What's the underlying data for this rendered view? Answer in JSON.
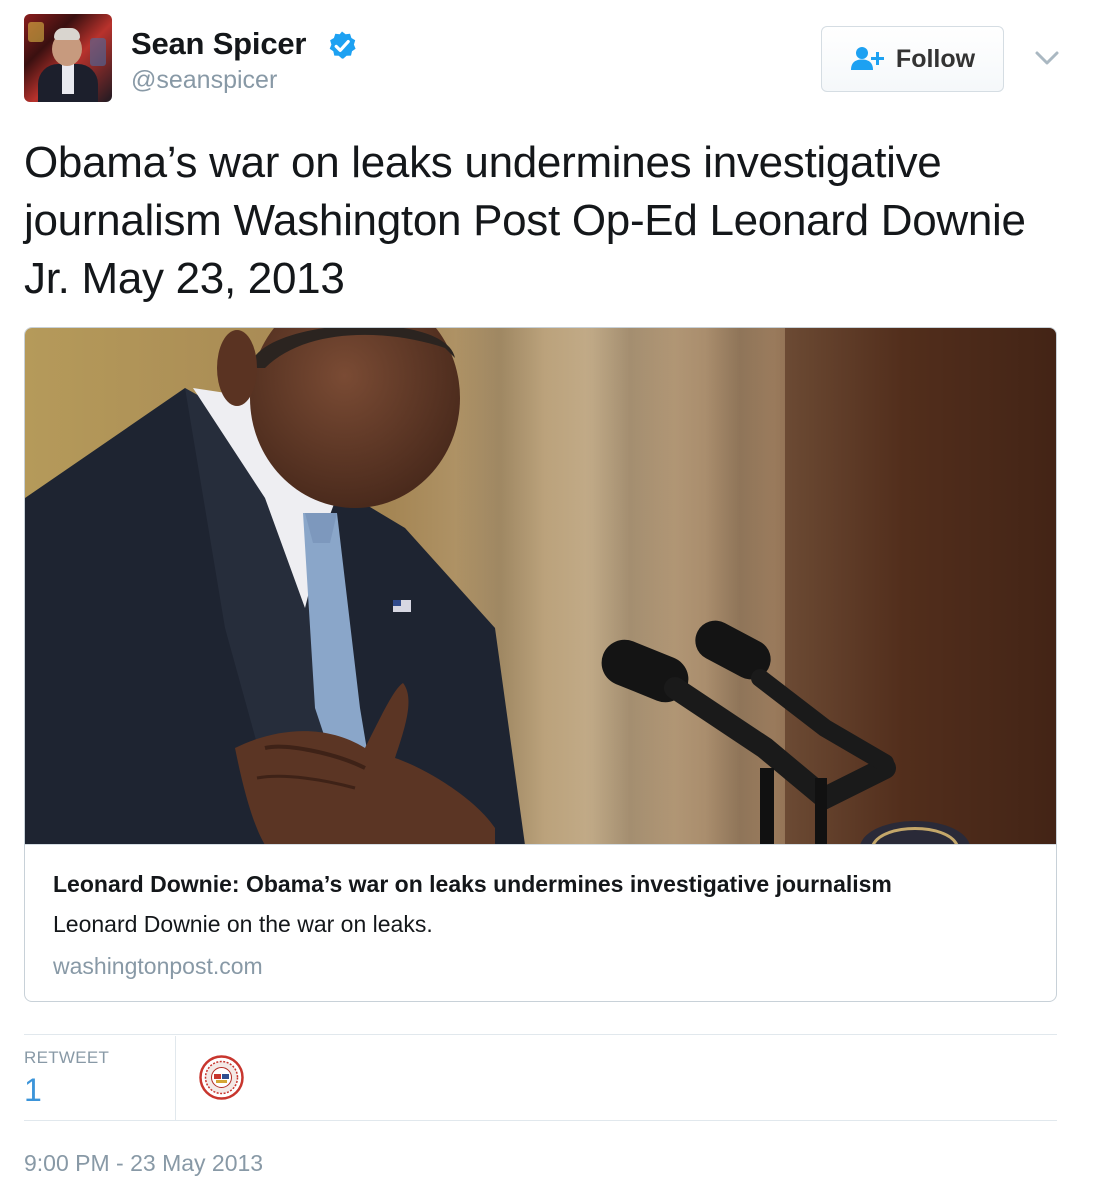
{
  "author": {
    "name": "Sean Spicer",
    "handle": "@seanspicer",
    "verified": true,
    "avatar_icon": "profile-photo"
  },
  "follow_button": {
    "label": "Follow",
    "icon": "person-plus-icon"
  },
  "menu_icon": "chevron-down-icon",
  "tweet_text": "Obama’s war on leaks undermines investigative journalism Washington Post Op-Ed Leonard Downie Jr. May 23, 2013",
  "card": {
    "image_description": "photo",
    "title": "Leonard Downie: Obama’s war on leaks undermines investigative journalism",
    "description": "Leonard Downie on the war on leaks.",
    "domain": "washingtonpost.com"
  },
  "stats": {
    "retweet_label": "RETWEET",
    "retweet_count": "1"
  },
  "timestamp": "9:00 PM - 23 May 2013",
  "colors": {
    "accent_blue": "#3b94d9",
    "verified_blue": "#1da1f2",
    "muted_text": "#8899a6",
    "border": "#e1e8ed"
  }
}
